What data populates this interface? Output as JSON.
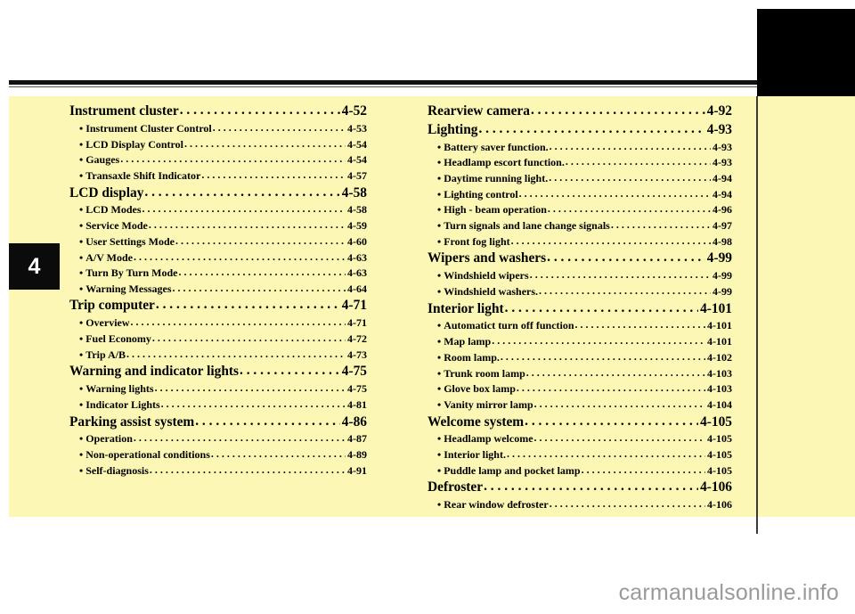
{
  "page": {
    "chapter_number": "4",
    "watermark": "carmanualsonline.info",
    "background_color": "#ffffff",
    "panel_color": "#fcf7b5",
    "rule_color": "#111111",
    "tab_color": "#0b0b0b"
  },
  "toc": {
    "left_column": [
      {
        "level": 1,
        "label": "Instrument cluster",
        "page": "4-52"
      },
      {
        "level": 2,
        "label": "Instrument Cluster Control",
        "page": "4-53"
      },
      {
        "level": 2,
        "label": "LCD Display Control",
        "page": "4-54"
      },
      {
        "level": 2,
        "label": "Gauges",
        "page": "4-54"
      },
      {
        "level": 2,
        "label": "Transaxle Shift Indicator",
        "page": "4-57"
      },
      {
        "level": 1,
        "label": "LCD display",
        "page": "4-58"
      },
      {
        "level": 2,
        "label": "LCD Modes",
        "page": "4-58"
      },
      {
        "level": 2,
        "label": "Service Mode",
        "page": "4-59"
      },
      {
        "level": 2,
        "label": "User Settings Mode",
        "page": "4-60"
      },
      {
        "level": 2,
        "label": "A/V Mode",
        "page": "4-63"
      },
      {
        "level": 2,
        "label": "Turn By Turn Mode",
        "page": "4-63"
      },
      {
        "level": 2,
        "label": "Warning Messages",
        "page": "4-64"
      },
      {
        "level": 1,
        "label": "Trip computer",
        "page": "4-71"
      },
      {
        "level": 2,
        "label": "Overview",
        "page": "4-71"
      },
      {
        "level": 2,
        "label": "Fuel Economy",
        "page": "4-72"
      },
      {
        "level": 2,
        "label": "Trip A/B",
        "page": "4-73"
      },
      {
        "level": 1,
        "label": "Warning and indicator lights",
        "page": "4-75"
      },
      {
        "level": 2,
        "label": "Warning lights",
        "page": "4-75"
      },
      {
        "level": 2,
        "label": "Indicator Lights",
        "page": "4-81"
      },
      {
        "level": 1,
        "label": "Parking assist system",
        "page": "4-86"
      },
      {
        "level": 2,
        "label": "Operation",
        "page": "4-87"
      },
      {
        "level": 2,
        "label": "Non-operational conditions",
        "page": "4-89"
      },
      {
        "level": 2,
        "label": "Self-diagnosis",
        "page": "4-91"
      }
    ],
    "right_column": [
      {
        "level": 1,
        "label": "Rearview camera",
        "page": "4-92"
      },
      {
        "level": 1,
        "label": "Lighting",
        "page": "4-93"
      },
      {
        "level": 2,
        "label": "Battery saver function.",
        "page": "4-93"
      },
      {
        "level": 2,
        "label": "Headlamp escort function.",
        "page": "4-93"
      },
      {
        "level": 2,
        "label": "Daytime running light.",
        "page": "4-94"
      },
      {
        "level": 2,
        "label": "Lighting control",
        "page": "4-94"
      },
      {
        "level": 2,
        "label": "High - beam operation",
        "page": "4-96"
      },
      {
        "level": 2,
        "label": "Turn signals and lane change signals",
        "page": "4-97"
      },
      {
        "level": 2,
        "label": "Front fog light",
        "page": "4-98"
      },
      {
        "level": 1,
        "label": "Wipers and washers",
        "page": "4-99"
      },
      {
        "level": 2,
        "label": "Windshield wipers",
        "page": "4-99"
      },
      {
        "level": 2,
        "label": "Windshield washers.",
        "page": "4-99"
      },
      {
        "level": 1,
        "label": "Interior light",
        "page": "4-101"
      },
      {
        "level": 2,
        "label": "Automatict turn off function",
        "page": "4-101"
      },
      {
        "level": 2,
        "label": "Map lamp",
        "page": "4-101"
      },
      {
        "level": 2,
        "label": "Room lamp.",
        "page": "4-102"
      },
      {
        "level": 2,
        "label": "Trunk room lamp",
        "page": "4-103"
      },
      {
        "level": 2,
        "label": "Glove box lamp",
        "page": "4-103"
      },
      {
        "level": 2,
        "label": "Vanity mirror lamp",
        "page": "4-104"
      },
      {
        "level": 1,
        "label": "Welcome system",
        "page": "4-105"
      },
      {
        "level": 2,
        "label": "Headlamp welcome",
        "page": "4-105"
      },
      {
        "level": 2,
        "label": "Interior light.",
        "page": "4-105"
      },
      {
        "level": 2,
        "label": "Puddle lamp and pocket lamp",
        "page": "4-105"
      },
      {
        "level": 1,
        "label": "Defroster",
        "page": "4-106"
      },
      {
        "level": 2,
        "label": "Rear window defroster",
        "page": "4-106"
      }
    ]
  }
}
